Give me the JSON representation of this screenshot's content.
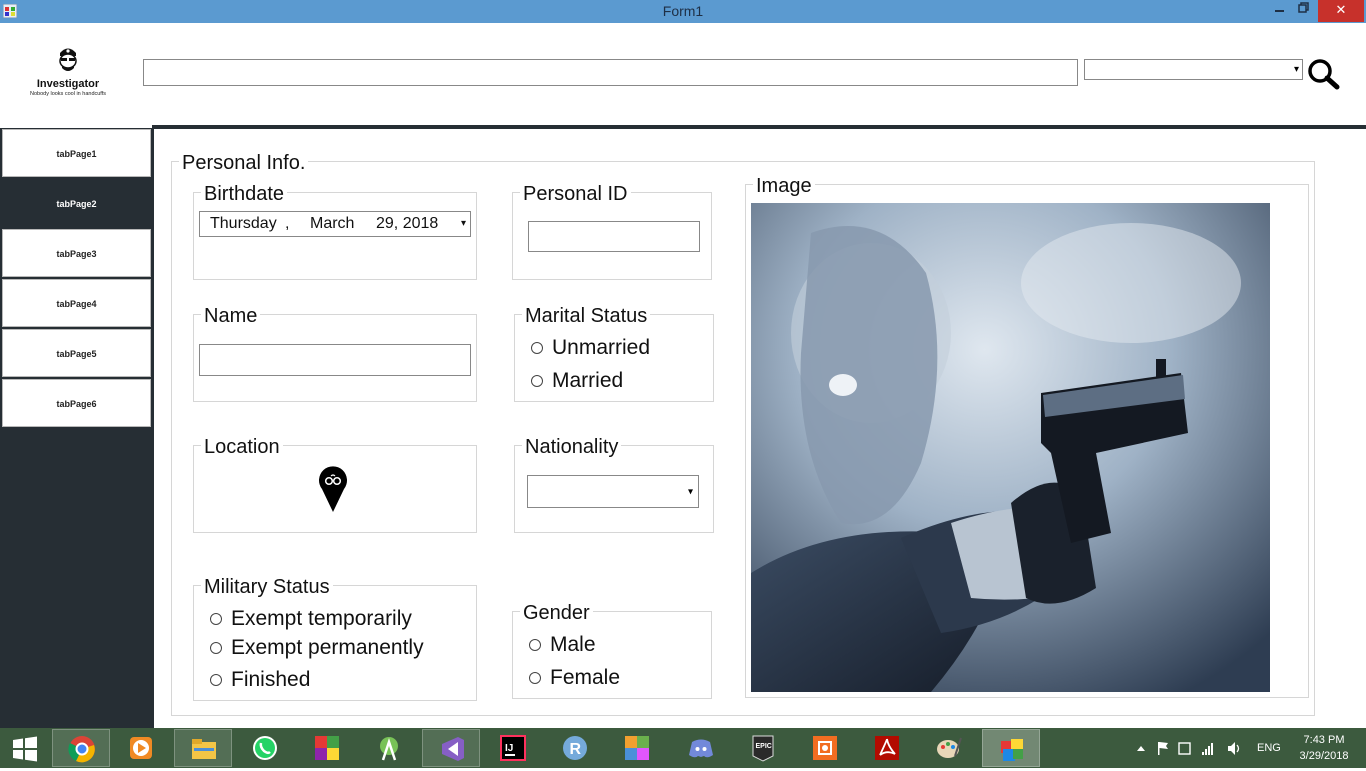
{
  "window": {
    "title": "Form1",
    "minimize_glyph": "🗕",
    "maximize_glyph": "🗗",
    "close_glyph": "✕"
  },
  "header": {
    "logo_name": "Investigator",
    "logo_slogan": "Nobody looks cool in handcuffs",
    "search_value": "",
    "search_select_value": "",
    "search_icon": "magnifier-icon"
  },
  "sidebar": {
    "tabs": [
      {
        "label": "tabPage1",
        "active": false
      },
      {
        "label": "tabPage2",
        "active": true
      },
      {
        "label": "tabPage3",
        "active": false
      },
      {
        "label": "tabPage4",
        "active": false
      },
      {
        "label": "tabPage5",
        "active": false
      },
      {
        "label": "tabPage6",
        "active": false
      }
    ]
  },
  "personal_info": {
    "title": "Personal Info.",
    "birthdate": {
      "label": "Birthdate",
      "day": "Thursday",
      "sep": ",",
      "month": "March",
      "date": "29, 2018"
    },
    "personal_id": {
      "label": "Personal ID",
      "value": ""
    },
    "name": {
      "label": "Name",
      "value": ""
    },
    "marital_status": {
      "label": "Marital Status",
      "options": [
        "Unmarried",
        "Married"
      ]
    },
    "location": {
      "label": "Location",
      "icon": "map-pin-icon"
    },
    "nationality": {
      "label": "Nationality",
      "value": ""
    },
    "military_status": {
      "label": "Military Status",
      "options": [
        "Exempt temporarily",
        "Exempt permanently",
        "Finished"
      ]
    },
    "gender": {
      "label": "Gender",
      "options": [
        "Male",
        "Female"
      ]
    },
    "image": {
      "label": "Image"
    }
  },
  "taskbar": {
    "apps": [
      "windows-start-icon",
      "chrome-icon",
      "media-player-icon",
      "file-explorer-icon",
      "whatsapp-icon",
      "winforms-icon",
      "android-studio-icon",
      "visual-studio-icon",
      "intellij-icon",
      "rstudio-icon",
      "mfc-icon",
      "discord-icon",
      "epic-games-icon",
      "capture-icon",
      "acrobat-icon",
      "paint-icon",
      "form-app-icon"
    ],
    "tray": {
      "language": "ENG",
      "time": "7:43 PM",
      "date": "3/29/2018"
    }
  },
  "colors": {
    "titlebar": "#5b9ad0",
    "sidebar": "#262e34",
    "close": "#c7312b"
  }
}
